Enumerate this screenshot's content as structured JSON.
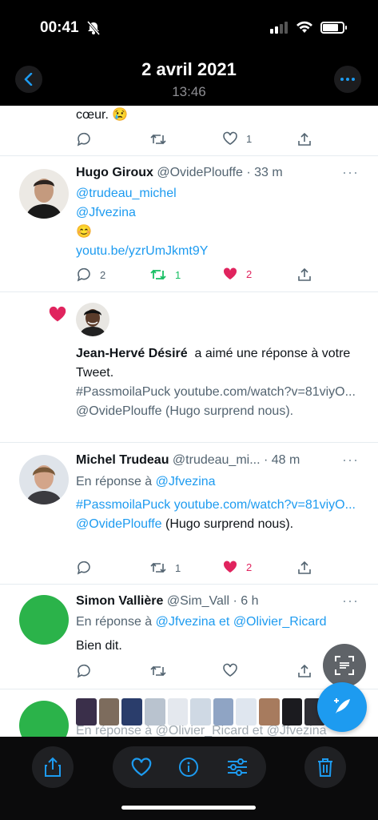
{
  "status_bar": {
    "time": "00:41"
  },
  "header": {
    "date": "2 avril 2021",
    "time": "13:46"
  },
  "tweets": {
    "top": {
      "text_end": "cœur. 😢",
      "like_count": "1"
    },
    "hugo": {
      "name": "Hugo Giroux",
      "handle_time": "@OvidePlouffe · 33 m",
      "mention1": "@trudeau_michel",
      "mention2": "@Jfvezina",
      "emoji": "😊",
      "link": "youtu.be/yzrUmJkmt9Y",
      "reply_count": "2",
      "retweet_count": "1",
      "like_count": "2"
    },
    "notification": {
      "name": "Jean-Hervé Désiré",
      "action": "a aimé une réponse à votre Tweet.",
      "tweet_text": "#PassmoilaPuck youtube.com/watch?v=81viyO... @OvidePlouffe (Hugo surprend nous)."
    },
    "michel": {
      "name": "Michel Trudeau",
      "handle_time": "@trudeau_mi... · 48 m",
      "reply_prefix": "En réponse à",
      "reply_to": "@Jfvezina",
      "hashtag": "#PassmoilaPuck",
      "link1": "youtube.com/watch?v=81viyO...",
      "mention": "@OvidePlouffe",
      "text_tail": "(Hugo surprend nous).",
      "retweet_count": "1",
      "like_count": "2"
    },
    "simon": {
      "name": "Simon Vallière",
      "handle_time": "@Sim_Vall · 6 h",
      "reply_prefix": "En réponse à",
      "reply_to": "@Jfvezina et @Olivier_Ricard",
      "text": "Bien dit."
    },
    "partial": {
      "reply_text": "En réponse à @Olivier_Ricard et @Jfvezina"
    }
  },
  "colors": {
    "accent": "#1d9bf0",
    "retweet_green": "#17bf63",
    "like_red": "#e0245e",
    "avatar_green": "#2bb34a"
  },
  "toolbar": {
    "icons": [
      "share-icon",
      "heart-icon",
      "info-icon",
      "adjust-icon",
      "trash-icon"
    ]
  }
}
